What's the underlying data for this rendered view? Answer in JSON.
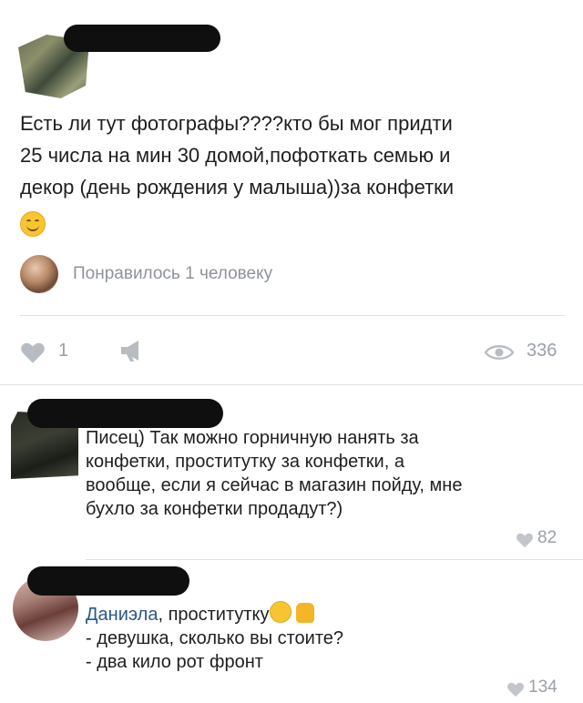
{
  "post": {
    "text_line1": "Есть ли тут фотографы????кто бы мог придти",
    "text_line2": "25 числа на мин 30 домой,пофоткать семью и",
    "text_line3": "декор (день рождения у малыша))за конфетки",
    "liked_text": "Понравилось 1 человеку",
    "likes": "1",
    "views": "336"
  },
  "comments": [
    {
      "lines": [
        "Писец) Так можно горничную нанять за",
        "конфетки, проститутку за конфетки, а",
        "вообще, если я сейчас в магазин пойду, мне",
        "бухло за конфетки продадут?)"
      ],
      "likes": "82"
    },
    {
      "reply_to": "Даниэла",
      "line1_rest": ", проститутку",
      "line2": "- девушка, сколько вы стоите?",
      "line3": "- два кило рот фронт",
      "likes": "134"
    }
  ],
  "colors": {
    "link": "#2a5885",
    "muted": "#9aa0a6",
    "divider": "#dde0e4"
  },
  "icons": [
    "heart-icon",
    "megaphone-icon",
    "eye-icon",
    "smile-emoji-icon",
    "laugh-emoji-icon",
    "thumbs-up-icon"
  ]
}
